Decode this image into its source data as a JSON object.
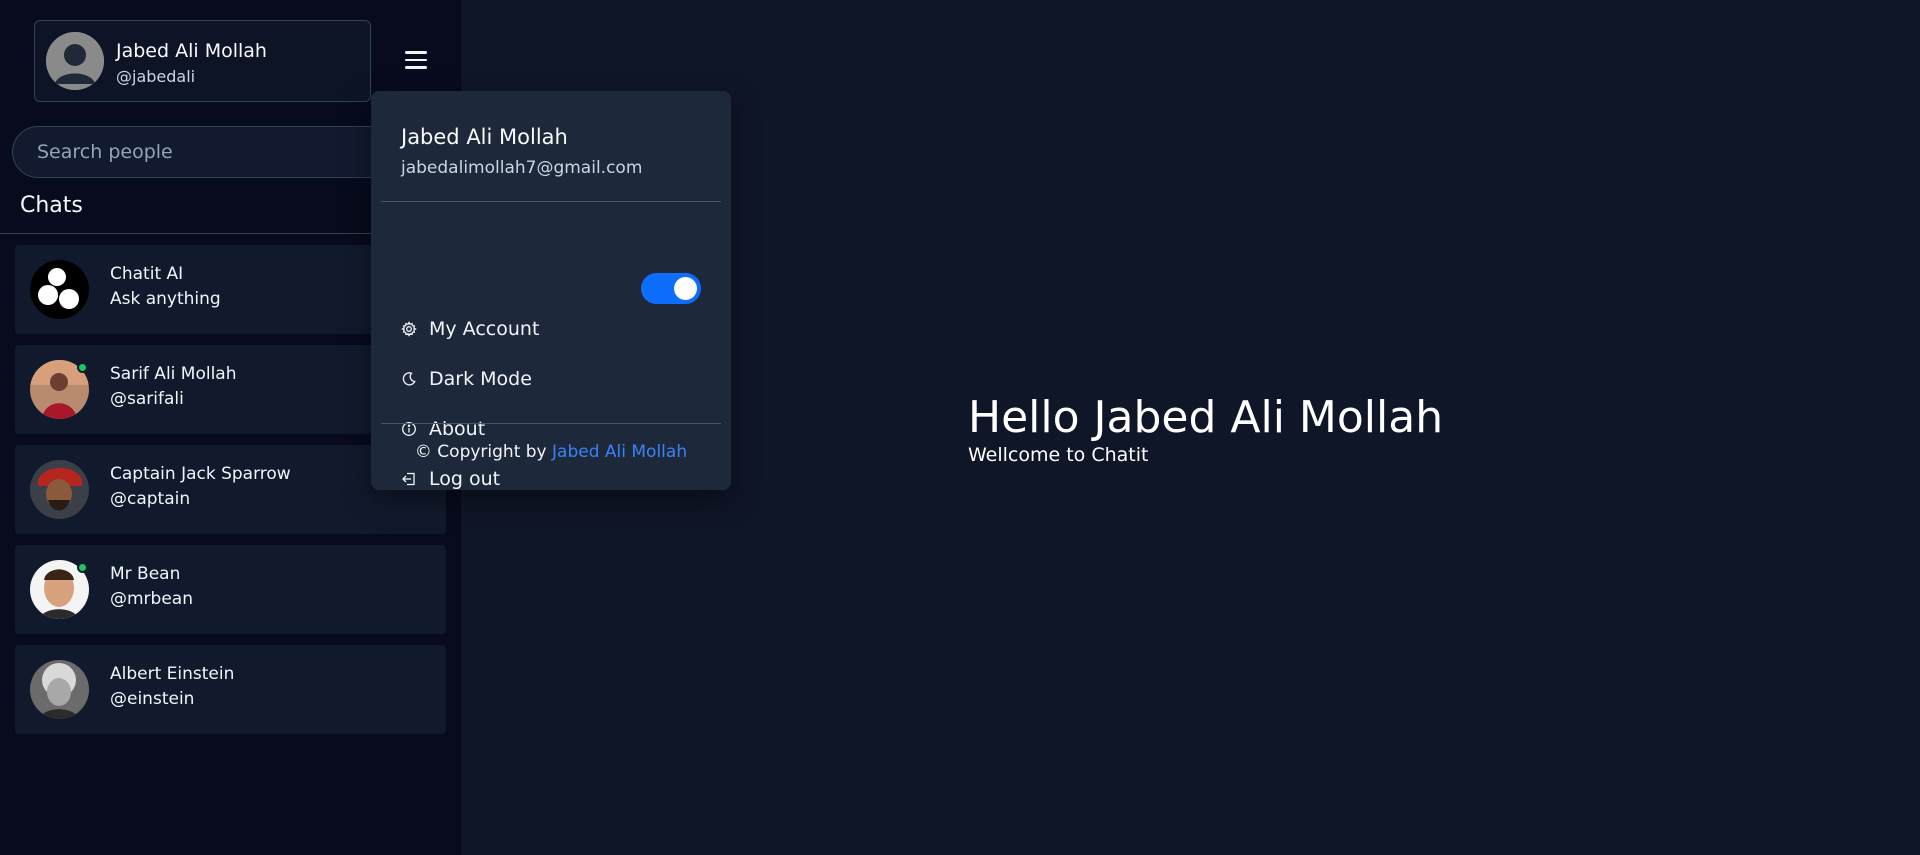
{
  "user": {
    "name": "Jabed Ali Mollah",
    "handle": "@jabedali",
    "email": "jabedalimollah7@gmail.com"
  },
  "search": {
    "placeholder": "Search people"
  },
  "chats": {
    "title": "Chats",
    "items": [
      {
        "name": "Chatit AI",
        "sub": "Ask anything",
        "online": false,
        "avatar": "chatit-logo"
      },
      {
        "name": "Sarif Ali Mollah",
        "sub": "@sarifali",
        "online": true,
        "avatar": "photo"
      },
      {
        "name": "Captain Jack Sparrow",
        "sub": "@captain",
        "online": false,
        "avatar": "photo"
      },
      {
        "name": "Mr Bean",
        "sub": "@mrbean",
        "online": true,
        "avatar": "photo"
      },
      {
        "name": "Albert Einstein",
        "sub": "@einstein",
        "online": false,
        "avatar": "photo"
      }
    ]
  },
  "menu": {
    "name": "Jabed Ali Mollah",
    "email": "jabedalimollah7@gmail.com",
    "items": [
      {
        "label": "My Account",
        "icon": "gear-icon"
      },
      {
        "label": "Dark Mode",
        "icon": "moon-icon",
        "toggle_on": true
      },
      {
        "label": "About",
        "icon": "info-icon"
      },
      {
        "label": "Log out",
        "icon": "logout-icon"
      }
    ],
    "footer_prefix": "© Copyright by",
    "footer_link": "Jabed Ali Mollah"
  },
  "main": {
    "greeting": "Hello Jabed Ali Mollah",
    "subtitle": "Wellcome to Chatit"
  },
  "colors": {
    "accent": "#0d6efd",
    "link": "#3b82f6",
    "online": "#22c55e",
    "sidebar_bg": "#070b1d",
    "main_bg": "#0f1628",
    "menu_bg": "#1e283b"
  }
}
